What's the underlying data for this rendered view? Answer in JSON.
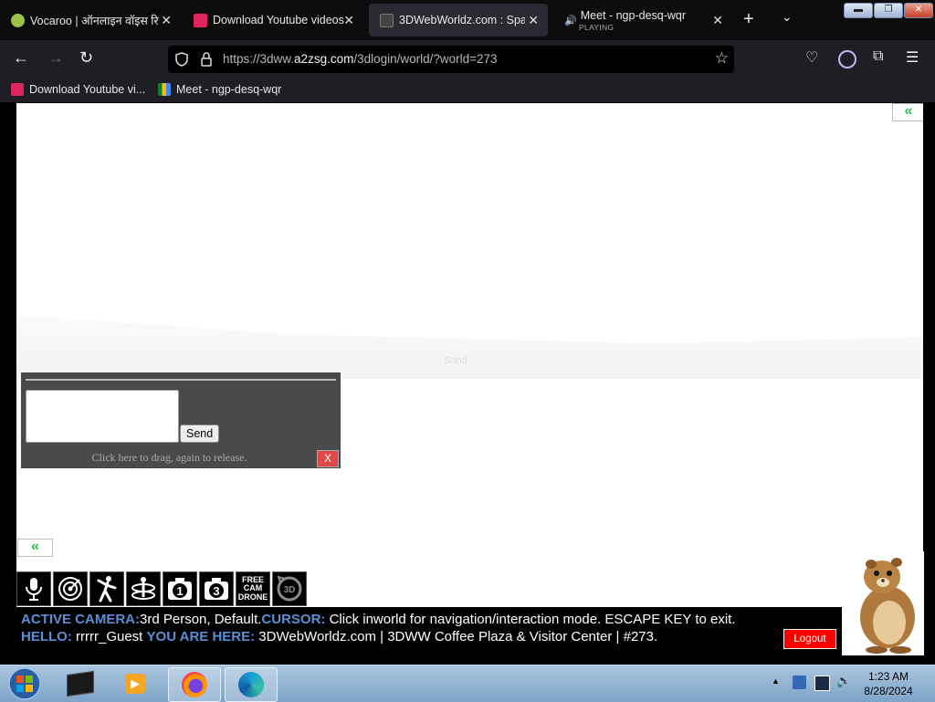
{
  "browser": {
    "tabs": [
      {
        "title": "Vocaroo | ऑनलाइन वॉइस रि",
        "active": false
      },
      {
        "title": "Download Youtube videos",
        "active": false
      },
      {
        "title": "3DWebWorldz.com : Spac",
        "active": true
      },
      {
        "title": "Meet - ngp-desq-wqr",
        "subtitle": "PLAYING",
        "active": false
      }
    ],
    "url_prefix": "https://3dww.",
    "url_domain": "a2zsg.com",
    "url_path": "/3dlogin/world/?world=273",
    "bookmarks": [
      {
        "title": "Download Youtube vi..."
      },
      {
        "title": "Meet - ngp-desq-wqr"
      }
    ]
  },
  "world": {
    "ground_label": "Sand",
    "collapse_symbol": "«",
    "chat": {
      "input_value": "",
      "send_label": "Send",
      "drag_hint": "Click here to drag, again to release.",
      "close_label": "X"
    },
    "tools": [
      {
        "icon": "microphone-icon",
        "label": ""
      },
      {
        "icon": "target-icon",
        "label": ""
      },
      {
        "icon": "dance-figure-icon",
        "label": ""
      },
      {
        "icon": "spin-figure-icon",
        "label": ""
      },
      {
        "icon": "camera-1-icon",
        "label": "1"
      },
      {
        "icon": "camera-3-icon",
        "label": "3"
      },
      {
        "icon": "free-cam-drone-icon",
        "label": "FREE CAM DRONE"
      },
      {
        "icon": "3d-rotate-icon",
        "label": "3D"
      }
    ],
    "status": {
      "camera_label": "ACTIVE CAMERA:",
      "camera_value": "3rd Person, Default.",
      "cursor_label": "CURSOR:",
      "cursor_value": " Click inworld for navigation/interaction mode. ESCAPE KEY to exit.",
      "hello_label": "HELLO:",
      "hello_value": " rrrrr_Guest ",
      "location_label": "YOU ARE HERE:",
      "location_value": " 3DWebWorldz.com | 3DWW Coffee Plaza & Visitor Center | #273.",
      "logout_label": "Logout"
    }
  },
  "taskbar": {
    "time": "1:23 AM",
    "date": "8/28/2024"
  },
  "colors": {
    "accent_green": "#2fb84a",
    "status_label_blue": "#5a8fd6",
    "logout_red": "#ff0000"
  }
}
